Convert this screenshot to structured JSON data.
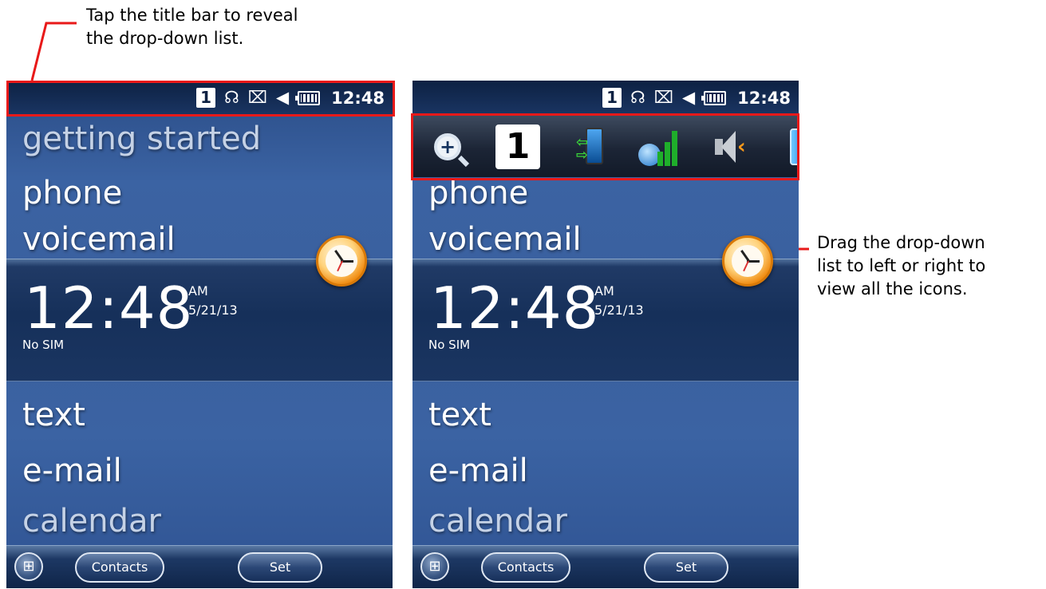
{
  "callouts": {
    "top": "Tap the title bar to reveal\nthe drop-down list.",
    "right": "Drag the drop-down\nlist to left or right to\nview all the icons."
  },
  "colors": {
    "highlight": "#e81919",
    "screen_background": "#3b63a3",
    "title_bar": "#0d2142"
  },
  "status_bar": {
    "sim_label": "1",
    "icons": [
      "sim-slot-icon",
      "wifi-sync-icon",
      "no-signal-icon",
      "speaker-mute-icon",
      "battery-icon"
    ],
    "time": "12:48"
  },
  "home_menu": {
    "getting_started": "getting started",
    "phone": "phone",
    "voicemail": "voicemail",
    "text": "text",
    "email": "e-mail",
    "calendar": "calendar"
  },
  "clock": {
    "time": "12:48",
    "ampm": "AM",
    "date": "5/21/13",
    "sim_status": "No SIM"
  },
  "softkeys": {
    "left": "Contacts",
    "right": "Set",
    "start_icon": "windows-start-icon"
  },
  "dropdown": {
    "icons": [
      "zoom-icon",
      "sim-slot-icon",
      "activesync-icon",
      "phone-signal-icon",
      "volume-icon",
      "battery-icon"
    ],
    "sim_label": "1",
    "zoom_symbol": "+"
  }
}
